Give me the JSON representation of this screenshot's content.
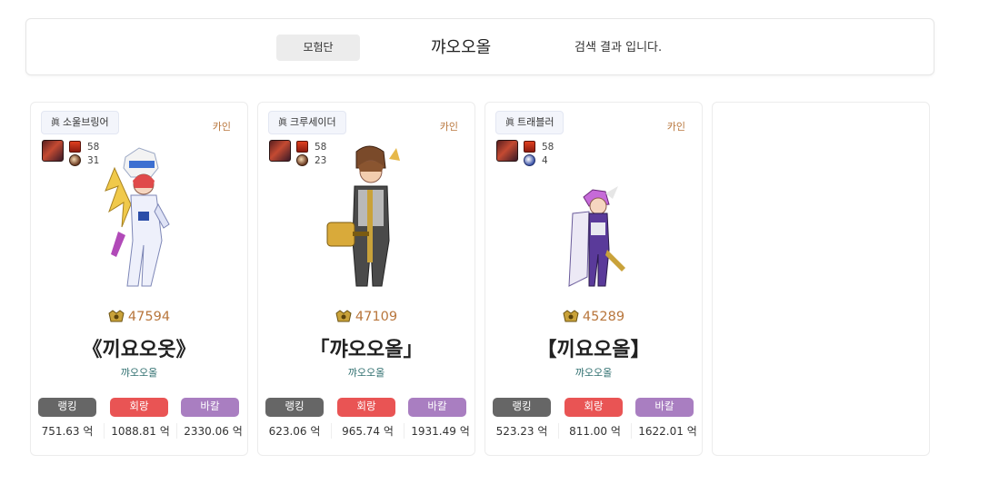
{
  "search": {
    "tag_label": "모험단",
    "query_name": "꺄오오올",
    "result_suffix": "검색 결과 입니다."
  },
  "stat_labels": {
    "ranking": "랭킹",
    "heal": "회랑",
    "bakal": "바칼"
  },
  "cards": [
    {
      "job_badge": "眞",
      "job": "소울브링어",
      "server": "카인",
      "buff_level": "58",
      "buff_count": "31",
      "fame": "47594",
      "name": "《끼요오옷》",
      "adventure": "꺄오오올",
      "ranking": "751.63 억",
      "heal": "1088.81 억",
      "bakal": "2330.06 억"
    },
    {
      "job_badge": "眞",
      "job": "크루세이더",
      "server": "카인",
      "buff_level": "58",
      "buff_count": "23",
      "fame": "47109",
      "name": "「꺄오오올」",
      "adventure": "꺄오오올",
      "ranking": "623.06 억",
      "heal": "965.74 억",
      "bakal": "1931.49 억"
    },
    {
      "job_badge": "眞",
      "job": "트래블러",
      "server": "카인",
      "buff_level": "58",
      "buff_count": "4",
      "fame": "45289",
      "name": "【끼요오올】",
      "adventure": "꺄오오올",
      "ranking": "523.23 억",
      "heal": "811.00 억",
      "bakal": "1622.01 억"
    }
  ],
  "colors": {
    "server": "#b8763c",
    "fame": "#b8763c",
    "adventure": "#2f6f6f",
    "ranking_btn": "#666666",
    "heal_btn": "#e95454",
    "bakal_btn": "#a97ec1"
  }
}
